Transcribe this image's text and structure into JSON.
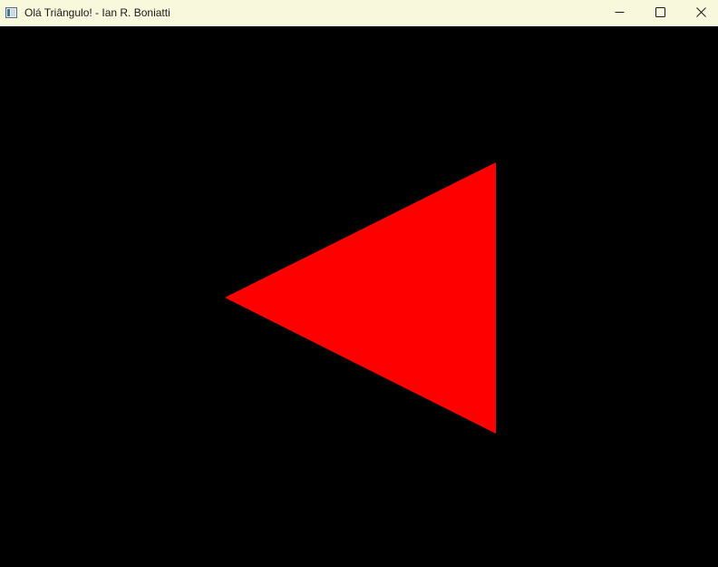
{
  "window": {
    "title": "Olá Triângulo! - Ian R. Boniatti",
    "icon": "app-window-icon",
    "controls": {
      "minimize_icon": "minimize-icon",
      "maximize_icon": "maximize-icon",
      "close_icon": "close-icon"
    }
  },
  "colors": {
    "titlebar": "#f8f8dc",
    "canvas_background": "#000000",
    "triangle_fill": "#ff0000"
  },
  "scene": {
    "shape": "triangle"
  }
}
